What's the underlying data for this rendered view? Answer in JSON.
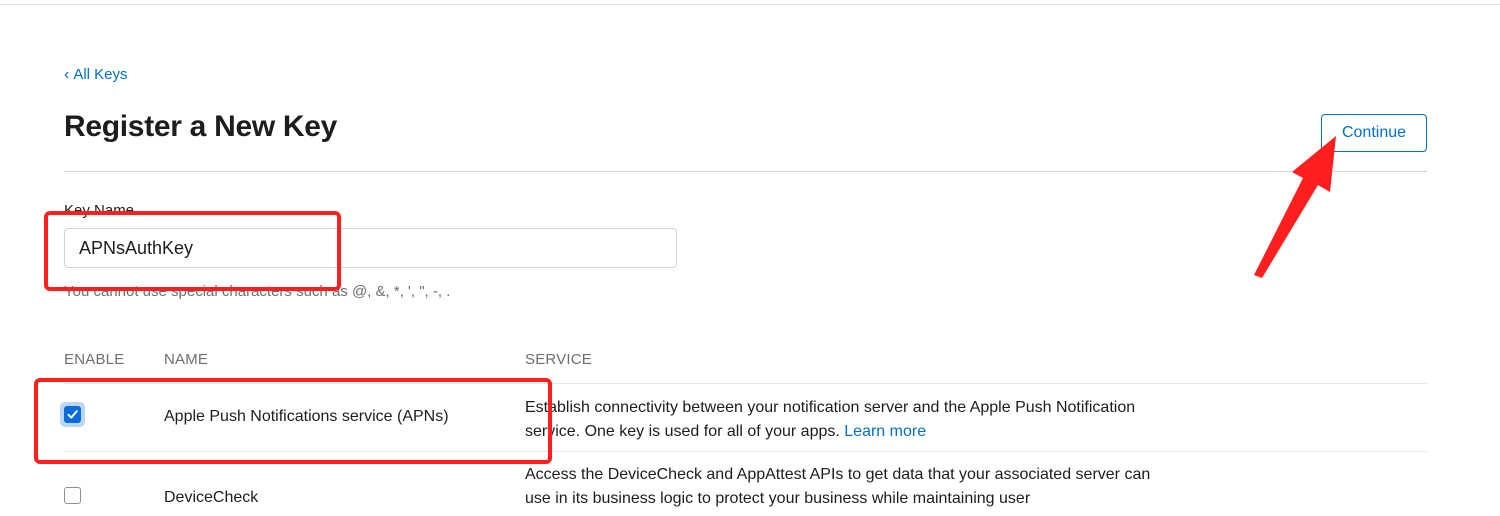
{
  "navigation": {
    "back_label": "All Keys"
  },
  "header": {
    "title": "Register a New Key",
    "continue_label": "Continue"
  },
  "key_form": {
    "label": "Key Name",
    "value": "APNsAuthKey",
    "hint": "You cannot use special characters such as @, &, *, ', \", -, ."
  },
  "services_table": {
    "columns": {
      "enable": "ENABLE",
      "name": "NAME",
      "service": "SERVICE"
    },
    "rows": [
      {
        "enabled": true,
        "name": "Apple Push Notifications service (APNs)",
        "description": "Establish connectivity between your notification server and the Apple Push Notification service. One key is used for all of your apps.",
        "link": "Learn more"
      },
      {
        "enabled": false,
        "name": "DeviceCheck",
        "description": "Access the DeviceCheck and AppAttest APIs to get data that your associated server can use in its business logic to protect your business while maintaining user"
      }
    ]
  },
  "colors": {
    "accent": "#0070c9",
    "annotation": "#ff1f1f",
    "checkbox": "#0a6cd9"
  },
  "icons": {
    "back": "chevron-left-icon",
    "checked": "checkmark-icon",
    "annotation": "arrow-icon"
  }
}
